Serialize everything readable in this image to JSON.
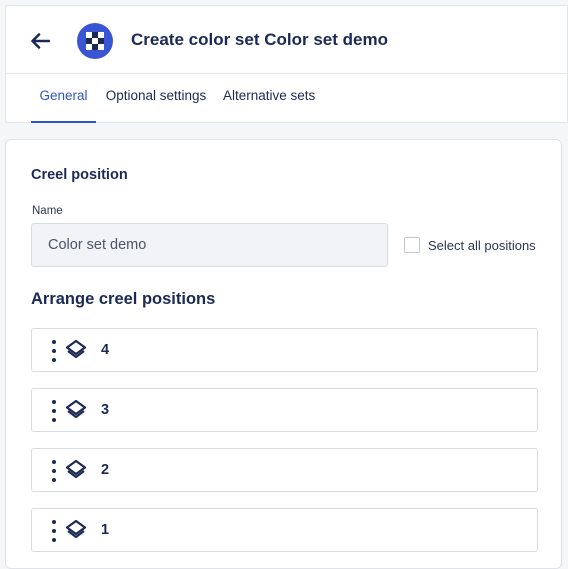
{
  "header": {
    "title": "Create color set Color set demo",
    "back_icon": "arrow-left-icon",
    "logo_icon": "checker-logo-icon"
  },
  "tabs": [
    {
      "label": "General",
      "active": true
    },
    {
      "label": "Optional settings",
      "active": false
    },
    {
      "label": "Alternative sets",
      "active": false
    }
  ],
  "form": {
    "section_title": "Creel position",
    "name_label": "Name",
    "name_value": "Color set demo",
    "select_all_label": "Select all positions",
    "select_all_checked": false,
    "arrange_title": "Arrange creel positions"
  },
  "positions": [
    {
      "label": "4"
    },
    {
      "label": "3"
    },
    {
      "label": "2"
    },
    {
      "label": "1"
    }
  ],
  "colors": {
    "accent": "#2f56c8",
    "text": "#1b2a55",
    "logo": "#3a55d4"
  }
}
